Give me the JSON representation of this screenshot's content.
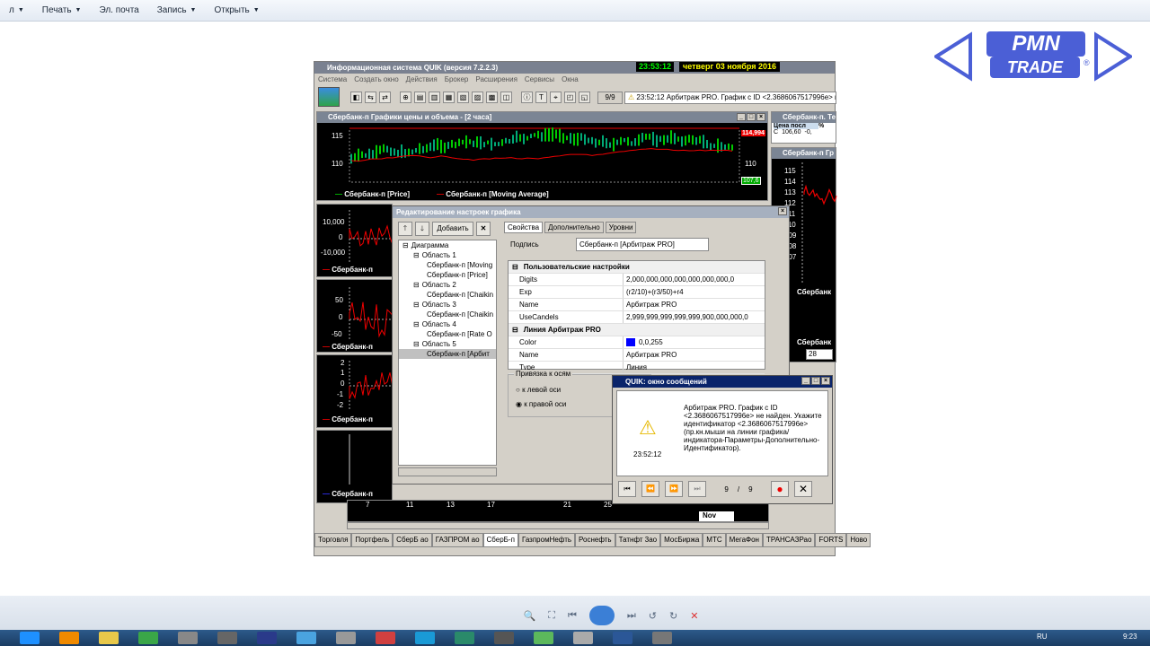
{
  "topbar": {
    "items": [
      {
        "label": "л",
        "arrow": "▼"
      },
      {
        "label": "Печать",
        "arrow": "▼"
      },
      {
        "label": "Эл. почта",
        "arrow": ""
      },
      {
        "label": "Запись",
        "arrow": "▼"
      },
      {
        "label": "Открыть",
        "arrow": "▼"
      }
    ]
  },
  "logo": {
    "line1": "PMN",
    "line2": "TRADE",
    "mark": "®",
    "color": "#4b5fd6"
  },
  "quik": {
    "title": "Информационная система QUIK (версия 7.2.2.3)",
    "time": "23:53:12",
    "date": "четверг 03 ноября 2016",
    "menu": [
      "Система",
      "Создать окно",
      "Действия",
      "Брокер",
      "Расширения",
      "Сервисы",
      "Окна"
    ],
    "counter": "9/9",
    "message": "23:52:12  Арбитраж PRO. График с ID <2.3686067517996e> не",
    "chart_title": "Сбербанк-п Графики цены и объема - [2 часа]",
    "right_title1": "Сбербанк-п. Те",
    "right_title2": "Сбербанк-п Гр",
    "right_col_header": "Цена посл",
    "right_col_header2": "%",
    "right_row": [
      "С",
      "106,60",
      "-0,"
    ],
    "price_axis": {
      "top": "115",
      "bottom": "110"
    },
    "price_marker_top": "114,994",
    "price_marker_mid": "110",
    "price_marker_bottom": "107,6",
    "legend_price": "Сбербанк-п [Price]",
    "legend_ma": "Сбербанк-п [Moving Average]",
    "panel2_axis": [
      "10,000",
      "0",
      "-10,000"
    ],
    "panel2_label": "Сбербанк-п",
    "panel3_axis": [
      "50",
      "0",
      "-50"
    ],
    "panel3_label": "Сбербанк-п",
    "panel4_axis": [
      "2",
      "1",
      "0",
      "-1",
      "-2"
    ],
    "panel4_label": "Сбербанк-п",
    "panel5_label": "Сбербанк-п",
    "right_axis": [
      "115",
      "114",
      "113",
      "112",
      "111",
      "110",
      "109",
      "108",
      "107",
      "5"
    ],
    "right_label1": "Сбербанк",
    "right_axis2": [
      "0",
      "0",
      "0",
      "0",
      "0"
    ],
    "right_label2": "Сбербанк",
    "right_box": "28",
    "date_axis": [
      "7",
      "11",
      "13",
      "17",
      "21",
      "25"
    ],
    "date_month": "Nov",
    "tabs": [
      "Торговля",
      "Портфель",
      "СберБ ао",
      "ГАЗПРОМ ао",
      "СберБ-п",
      "ГазпромНефть",
      "Роснефть",
      "Татнфт 3ао",
      "МосБиржа",
      "МТС",
      "МегаФон",
      "ТРАНСАЗРао",
      "FORTS",
      "Ново"
    ]
  },
  "dialog": {
    "title": "Редактирование настроек графика",
    "add_button": "Добавить",
    "tree": [
      {
        "text": "Диаграмма",
        "level": 0,
        "sign": "⊟"
      },
      {
        "text": "Область 1",
        "level": 1,
        "sign": "⊟"
      },
      {
        "text": "Сбербанк-п [Moving",
        "level": 2,
        "sign": ""
      },
      {
        "text": "Сбербанк-п [Price]",
        "level": 2,
        "sign": ""
      },
      {
        "text": "Область 2",
        "level": 1,
        "sign": "⊟"
      },
      {
        "text": "Сбербанк-п [Chaikin",
        "level": 2,
        "sign": ""
      },
      {
        "text": "Область 3",
        "level": 1,
        "sign": "⊟"
      },
      {
        "text": "Сбербанк-п [Chaikin",
        "level": 2,
        "sign": ""
      },
      {
        "text": "Область 4",
        "level": 1,
        "sign": "⊟"
      },
      {
        "text": "Сбербанк-п [Rate O",
        "level": 2,
        "sign": ""
      },
      {
        "text": "Область 5",
        "level": 1,
        "sign": "⊟"
      },
      {
        "text": "Сбербанк-п [Арбит",
        "level": 2,
        "sign": "",
        "selected": true
      }
    ],
    "tabs": [
      "Свойства",
      "Дополнительно",
      "Уровни"
    ],
    "caption_label": "Подпись",
    "caption_value": "Сбербанк-п [Арбитраж PRO]",
    "section1": "Пользовательские настройки",
    "props1": [
      {
        "name": "Digits",
        "value": "2,000,000,000,000,000,000,000,0"
      },
      {
        "name": "Exp",
        "value": "(r2/10)+(r3/50)+r4"
      },
      {
        "name": "Name",
        "value": "Арбитраж PRO"
      },
      {
        "name": "UseCandels",
        "value": "2,999,999,999,999,999,900,000,000,0"
      }
    ],
    "section2": "Линия Арбитраж PRO",
    "props2": [
      {
        "name": "Color",
        "value": "0,0,255",
        "swatch": "#0000ff"
      },
      {
        "name": "Name",
        "value": "Арбитраж PRO"
      },
      {
        "name": "Type",
        "value": "Линия"
      }
    ],
    "axis_group": "Привязка к осям",
    "radio_left": "к левой оси",
    "radio_right": "к правой оси"
  },
  "msgbox": {
    "title": "QUIK: окно сообщений",
    "text": "Арбитраж PRO. График с ID <2.3686067517996e> не найден. Укажите идентификатор <2.3686067517996e> (пр.кн.мыши на линии графика/индикатора-Параметры-Дополнительно-Идентификатор).",
    "time": "23:52:12",
    "page": "9",
    "sep": "/",
    "total": "9"
  },
  "taskbar": {
    "lang": "RU",
    "clock": "9:23"
  }
}
